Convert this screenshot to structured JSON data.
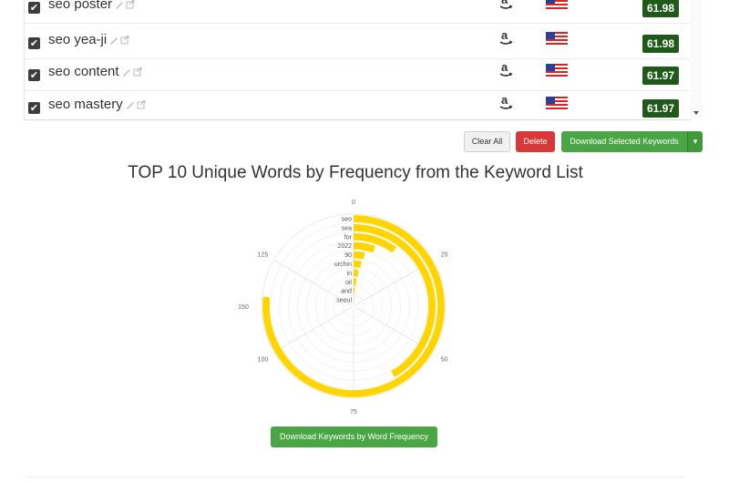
{
  "keywords": [
    {
      "text": "seo poster",
      "checked": true,
      "source_icon": "amazon-icon",
      "flag": "us-flag-icon",
      "score": "61.98"
    },
    {
      "text": "seo yea-ji",
      "checked": true,
      "source_icon": "amazon-icon",
      "flag": "us-flag-icon",
      "score": "61.98"
    },
    {
      "text": "seo content",
      "checked": true,
      "source_icon": "amazon-icon",
      "flag": "us-flag-icon",
      "score": "61.97"
    },
    {
      "text": "seo mastery",
      "checked": true,
      "source_icon": "amazon-icon",
      "flag": "us-flag-icon",
      "score": "61.97"
    }
  ],
  "actions": {
    "clear_all": "Clear All",
    "delete": "Delete",
    "download_selected": "Download Selected Keywords"
  },
  "chart_title": "TOP 10 Unique Words by Frequency from the Keyword List",
  "download_frequency": "Download Keywords by Word Frequency",
  "colors": {
    "score_bg": "#1f5a1a",
    "delete": "#d9383a",
    "download": "#4aa544",
    "bar": "#ffd500"
  },
  "chart_data": {
    "type": "radial-bar",
    "title": "TOP 10 Unique Words by Frequency from the Keyword List",
    "categories": [
      "seo",
      "sea",
      "for",
      "2022",
      "90",
      "urchin",
      "in",
      "oil",
      "and",
      "seoul"
    ],
    "values": [
      138,
      75,
      18,
      10,
      6,
      5,
      4,
      3,
      2,
      1
    ],
    "axis_ticks": [
      0,
      25,
      50,
      75,
      100,
      125,
      150
    ],
    "axis_max": 150,
    "series": [
      {
        "values": [
          138,
          75,
          18,
          10,
          6,
          5,
          4,
          3,
          2,
          1
        ],
        "color": "#ffd500"
      }
    ]
  }
}
